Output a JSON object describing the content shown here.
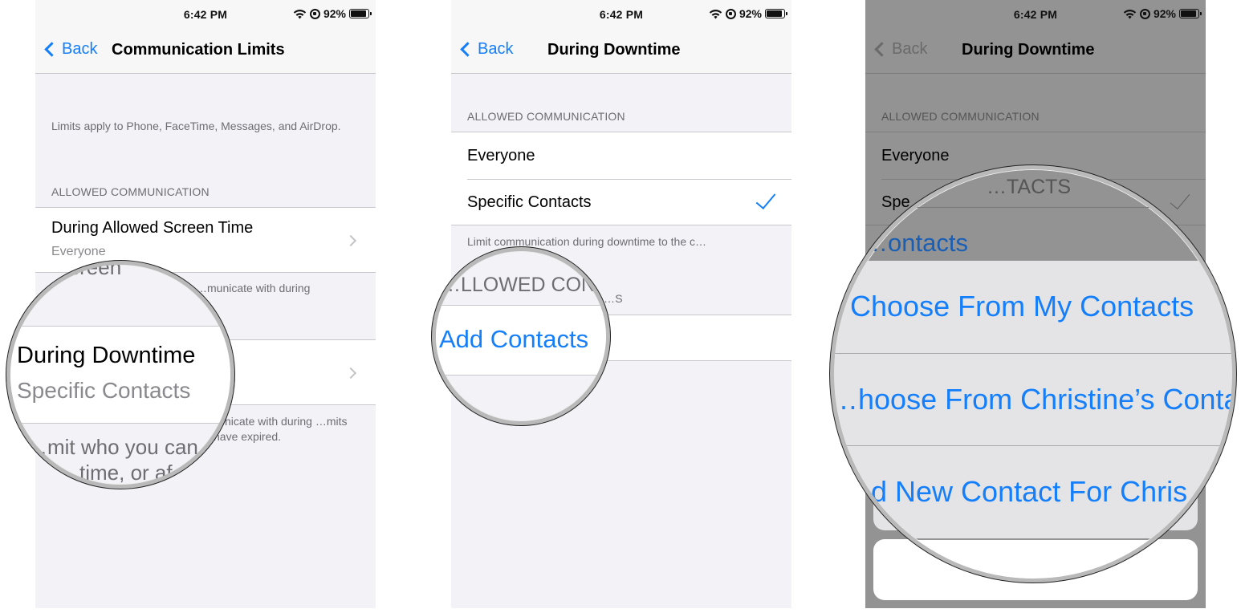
{
  "status_bar": {
    "time": "6:42 PM",
    "battery_percent": "92%",
    "battery_level": 0.92,
    "icons": [
      "wifi-icon",
      "orientation-lock-icon",
      "battery-icon"
    ]
  },
  "colors": {
    "accent": "#147efb",
    "grouped_background": "#f2f2f7",
    "dimmed_background": "#939393",
    "secondary_text": "#6d6d72"
  },
  "screens": [
    {
      "back_label": "Back",
      "title": "Communication Limits",
      "intro_footnote": "Limits apply to Phone, FaceTime, Messages, and AirDrop.",
      "section_header": "ALLOWED COMMUNICATION",
      "cells": [
        {
          "title": "During Allowed Screen Time",
          "value": "Everyone",
          "footnote_visible": "…municate with during"
        },
        {
          "title": "During Downtime",
          "value": "Specific Contacts",
          "footnote_visible": "…nicate with during …mits have expired."
        }
      ],
      "magnifier": {
        "top_fragment": "…ed screen",
        "title": "During Downtime",
        "value": "Specific Contacts",
        "footnote_line1": "…mit who you can",
        "footnote_line2": "…time, or af…"
      }
    },
    {
      "back_label": "Back",
      "title": "During Downtime",
      "section_header": "ALLOWED COMMUNICATION",
      "options": [
        {
          "label": "Everyone",
          "selected": false
        },
        {
          "label": "Specific Contacts",
          "selected": true
        }
      ],
      "footnote": "Limit communication during downtime to the c…",
      "contacts_header_partial": "…S",
      "add_contacts_label": "Add Contacts",
      "magnifier": {
        "header_fragment": "…LLOWED CON…",
        "action": "Add Contacts"
      }
    },
    {
      "back_label": "Back",
      "title": "During Downtime",
      "section_header": "ALLOWED COMMUNICATION",
      "options": [
        {
          "label": "Everyone",
          "selected": false
        },
        {
          "label": "Spe…",
          "selected": true
        }
      ],
      "magnifier": {
        "header_fragment": "…TACTS",
        "behind_action_fragment": "…ontacts",
        "action_sheet": [
          "Choose From My Contacts",
          "…hoose From Christine’s Contac…",
          "…d New Contact For Chris…"
        ]
      }
    }
  ]
}
